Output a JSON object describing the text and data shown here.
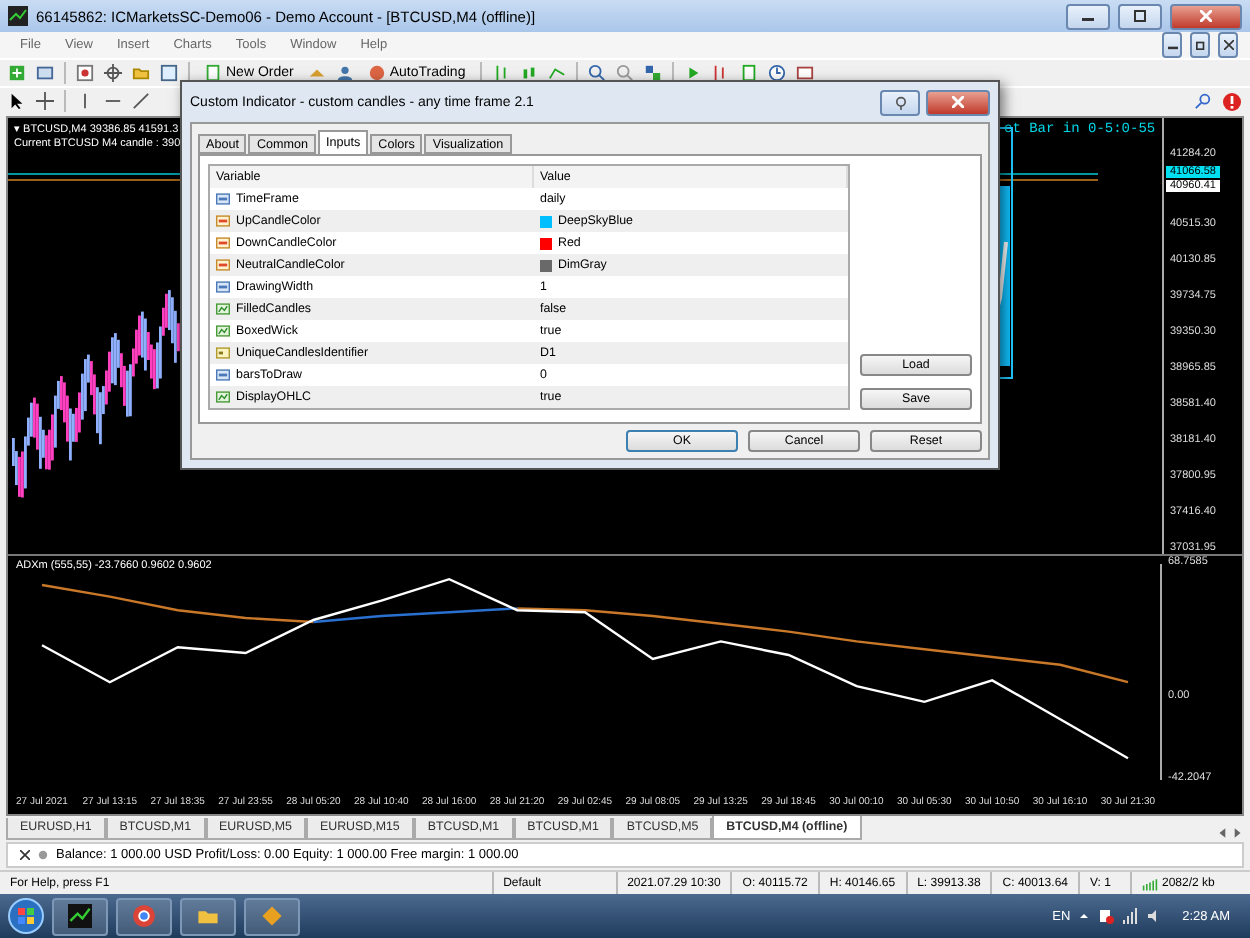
{
  "window": {
    "title": "66145862: ICMarketsSC-Demo06 - Demo Account - [BTCUSD,M4 (offline)]"
  },
  "menu": [
    "File",
    "View",
    "Insert",
    "Charts",
    "Tools",
    "Window",
    "Help"
  ],
  "toolbar": {
    "new_order": "New Order",
    "autotrading": "AutoTrading"
  },
  "chart": {
    "symbol_line": "▾ BTCUSD,M4  39386.85 41591.3",
    "candle_line": "Current BTCUSD M4 candle : 390",
    "timer": "ct Bar in 0-5:0-55",
    "price_axis": [
      "41284.20",
      "40515.30",
      "40130.85",
      "39734.75",
      "39350.30",
      "38965.85",
      "38581.40",
      "38181.40",
      "37800.95",
      "37416.40",
      "37031.95"
    ],
    "bid_tag": "41066.58",
    "ask_tag": "40960.41"
  },
  "indicator": {
    "label": "ADXm (555,55) -23.7660 0.9602 0.9602",
    "chart_data": {
      "type": "line",
      "categories": [
        "27 Jul 2021",
        "27 Jul 13:15",
        "27 Jul 18:35",
        "27 Jul 23:55",
        "28 Jul 05:20",
        "28 Jul 10:40",
        "28 Jul 16:00",
        "28 Jul 21:20",
        "29 Jul 02:45",
        "29 Jul 08:05",
        "29 Jul 13:25",
        "29 Jul 18:45",
        "30 Jul 00:10",
        "30 Jul 05:30",
        "30 Jul 10:50",
        "30 Jul 16:10",
        "30 Jul 21:30"
      ],
      "ylim": [
        -42.2047,
        68.7585
      ],
      "yticks": [
        {
          "value": 68.7585,
          "label": "68.7585"
        },
        {
          "value": 0,
          "label": "0.00"
        },
        {
          "value": -42.2047,
          "label": "-42.2047"
        }
      ],
      "series": [
        {
          "color": "#c87828",
          "values": [
            58,
            52,
            45,
            41,
            39,
            null,
            null,
            46,
            45,
            42,
            38,
            34,
            29,
            25,
            21,
            17,
            8
          ]
        },
        {
          "color": "#2a70d0",
          "values": [
            null,
            null,
            null,
            null,
            39,
            42,
            44,
            46,
            null,
            null,
            null,
            null,
            null,
            null,
            null,
            null,
            null
          ]
        },
        {
          "color": "#ffffff",
          "values": [
            27,
            8,
            26,
            23,
            40,
            50,
            61,
            45,
            44,
            20,
            29,
            22,
            6,
            -2,
            9,
            -11,
            -31
          ]
        }
      ]
    }
  },
  "chart_tabs": [
    {
      "label": "EURUSD,H1",
      "selected": false
    },
    {
      "label": "BTCUSD,M1",
      "selected": false
    },
    {
      "label": "EURUSD,M5",
      "selected": false
    },
    {
      "label": "EURUSD,M15",
      "selected": false
    },
    {
      "label": "BTCUSD,M1",
      "selected": false
    },
    {
      "label": "BTCUSD,M1",
      "selected": false
    },
    {
      "label": "BTCUSD,M5",
      "selected": false
    },
    {
      "label": "BTCUSD,M4 (offline)",
      "selected": true
    }
  ],
  "account": "Balance: 1 000.00 USD  Profit/Loss: 0.00  Equity: 1 000.00  Free margin: 1 000.00",
  "status_bar": {
    "help": "For Help, press F1",
    "profile": "Default",
    "time": "2021.07.29 10:30",
    "open": "O: 40115.72",
    "high": "H: 40146.65",
    "low": "L: 39913.38",
    "close": "C: 40013.64",
    "volume": "V: 1",
    "traffic": "2082/2 kb"
  },
  "taskbar": {
    "language": "EN",
    "clock": "2:28 AM"
  },
  "dialog": {
    "title": "Custom Indicator - custom candles - any time frame 2.1",
    "tabs": [
      {
        "label": "About",
        "selected": false
      },
      {
        "label": "Common",
        "selected": false
      },
      {
        "label": "Inputs",
        "selected": true
      },
      {
        "label": "Colors",
        "selected": false
      },
      {
        "label": "Visualization",
        "selected": false
      }
    ],
    "columns": [
      "Variable",
      "Value"
    ],
    "rows": [
      {
        "kind": "number",
        "variable": "TimeFrame",
        "value": "daily"
      },
      {
        "kind": "color",
        "variable": "UpCandleColor",
        "value": "DeepSkyBlue",
        "color": "#00bfff"
      },
      {
        "kind": "color",
        "variable": "DownCandleColor",
        "value": "Red",
        "color": "#ff0000"
      },
      {
        "kind": "color",
        "variable": "NeutralCandleColor",
        "value": "DimGray",
        "color": "#696969"
      },
      {
        "kind": "number",
        "variable": "DrawingWidth",
        "value": "1"
      },
      {
        "kind": "bool",
        "variable": "FilledCandles",
        "value": "false"
      },
      {
        "kind": "bool",
        "variable": "BoxedWick",
        "value": "true"
      },
      {
        "kind": "text",
        "variable": "UniqueCandlesIdentifier",
        "value": "D1"
      },
      {
        "kind": "number",
        "variable": "barsToDraw",
        "value": "0"
      },
      {
        "kind": "bool",
        "variable": "DisplayOHLC",
        "value": "true"
      }
    ],
    "side_buttons": [
      "Load",
      "Save"
    ],
    "buttons": [
      "OK",
      "Cancel",
      "Reset"
    ]
  }
}
